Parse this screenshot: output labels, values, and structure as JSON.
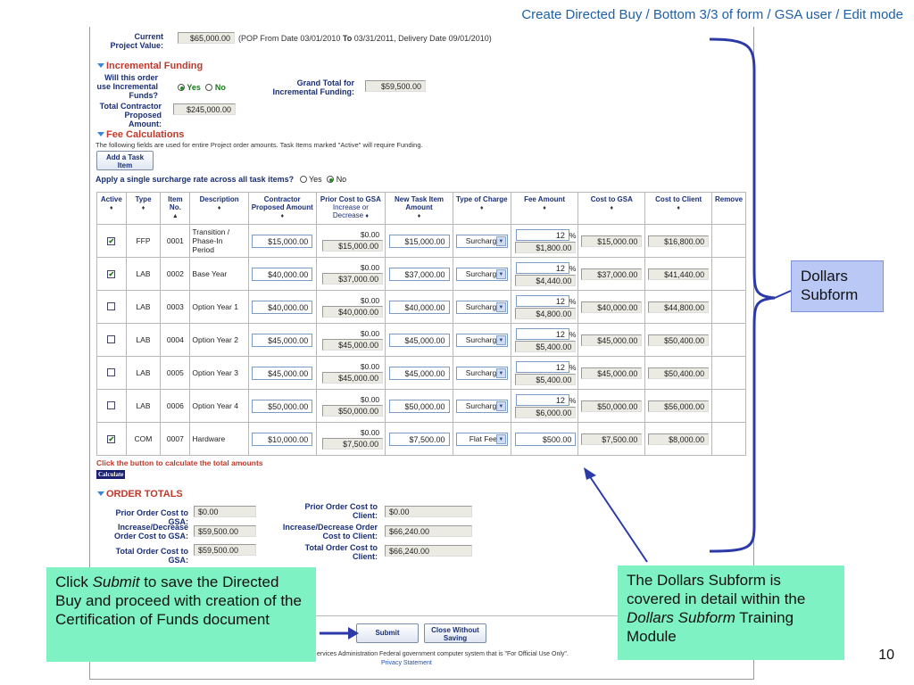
{
  "slide": {
    "title": "Create Directed Buy / Bottom 3/3 of form / GSA user / Edit mode",
    "page_number": "10"
  },
  "project": {
    "current_value_label": "Current Project Value:",
    "current_value": "$65,000.00",
    "pop_text_prefix": "(POP From Date 03/01/2010",
    "pop_to": "To",
    "pop_text_suffix": "03/31/2011, Delivery Date 09/01/2010)"
  },
  "incremental": {
    "title": "Incremental Funding",
    "question": "Will this order use Incremental Funds?",
    "yes": "Yes",
    "no": "No",
    "grand_total_label": "Grand Total for Incremental Funding:",
    "grand_total": "$59,500.00",
    "contractor_label": "Total Contractor Proposed Amount:",
    "contractor_amount": "$245,000.00"
  },
  "fees": {
    "title": "Fee Calculations",
    "note": "The following fields are used for entire Project order amounts. Task Items marked \"Active\" will require Funding.",
    "add_button": "Add a Task Item",
    "surcharge_question": "Apply a single surcharge rate across all task items?",
    "yes": "Yes",
    "no": "No"
  },
  "table": {
    "headers": {
      "active": "Active",
      "type": "Type",
      "item_no": "Item No.",
      "description": "Description",
      "contractor": "Contractor Proposed Amount",
      "prior": "Prior Cost to GSA",
      "prior_sub": "Increase or Decrease",
      "new_task": "New Task Item Amount",
      "charge_type": "Type of Charge",
      "fee": "Fee Amount",
      "cost_gsa": "Cost to GSA",
      "cost_client": "Cost to Client",
      "remove": "Remove"
    },
    "rows": [
      {
        "active": true,
        "type": "FFP",
        "item": "0001",
        "desc": "Transition / Phase-In Period",
        "contractor": "$15,000.00",
        "prior_delta": "$0.00",
        "prior": "$15,000.00",
        "new_amount": "$15,000.00",
        "charge": "Surcharge",
        "fee_pct": "12",
        "fee_amt": "$1,800.00",
        "gsa": "$15,000.00",
        "client": "$16,800.00"
      },
      {
        "active": true,
        "type": "LAB",
        "item": "0002",
        "desc": "Base Year",
        "contractor": "$40,000.00",
        "prior_delta": "$0.00",
        "prior": "$37,000.00",
        "new_amount": "$37,000.00",
        "charge": "Surcharge",
        "fee_pct": "12",
        "fee_amt": "$4,440.00",
        "gsa": "$37,000.00",
        "client": "$41,440.00"
      },
      {
        "active": false,
        "type": "LAB",
        "item": "0003",
        "desc": "Option Year 1",
        "contractor": "$40,000.00",
        "prior_delta": "$0.00",
        "prior": "$40,000.00",
        "new_amount": "$40,000.00",
        "charge": "Surcharge",
        "fee_pct": "12",
        "fee_amt": "$4,800.00",
        "gsa": "$40,000.00",
        "client": "$44,800.00"
      },
      {
        "active": false,
        "type": "LAB",
        "item": "0004",
        "desc": "Option Year 2",
        "contractor": "$45,000.00",
        "prior_delta": "$0.00",
        "prior": "$45,000.00",
        "new_amount": "$45,000.00",
        "charge": "Surcharge",
        "fee_pct": "12",
        "fee_amt": "$5,400.00",
        "gsa": "$45,000.00",
        "client": "$50,400.00"
      },
      {
        "active": false,
        "type": "LAB",
        "item": "0005",
        "desc": "Option Year 3",
        "contractor": "$45,000.00",
        "prior_delta": "$0.00",
        "prior": "$45,000.00",
        "new_amount": "$45,000.00",
        "charge": "Surcharge",
        "fee_pct": "12",
        "fee_amt": "$5,400.00",
        "gsa": "$45,000.00",
        "client": "$50,400.00"
      },
      {
        "active": false,
        "type": "LAB",
        "item": "0006",
        "desc": "Option Year 4",
        "contractor": "$50,000.00",
        "prior_delta": "$0.00",
        "prior": "$50,000.00",
        "new_amount": "$50,000.00",
        "charge": "Surcharge",
        "fee_pct": "12",
        "fee_amt": "$6,000.00",
        "gsa": "$50,000.00",
        "client": "$56,000.00"
      },
      {
        "active": true,
        "type": "COM",
        "item": "0007",
        "desc": "Hardware",
        "contractor": "$10,000.00",
        "prior_delta": "$0.00",
        "prior": "$7,500.00",
        "new_amount": "$7,500.00",
        "charge": "Flat Fee",
        "fee_pct": "",
        "fee_amt": "$500.00",
        "gsa": "$7,500.00",
        "client": "$8,000.00"
      }
    ],
    "percent_sign": "%",
    "sort_glyph": "♦",
    "sort_up_glyph": "▲"
  },
  "calc": {
    "hint": "Click the button to calculate the total amounts",
    "button": "Calculate"
  },
  "totals": {
    "title": "ORDER TOTALS",
    "prior_gsa_label": "Prior Order Cost to GSA:",
    "prior_gsa": "$0.00",
    "prior_client_label": "Prior Order Cost to Client:",
    "prior_client": "$0.00",
    "incdec_gsa_label": "Increase/Decrease Order Cost to GSA:",
    "incdec_gsa": "$59,500.00",
    "incdec_client_label": "Increase/Decrease Order Cost to Client:",
    "incdec_client": "$66,240.00",
    "total_gsa_label": "Total Order Cost to GSA:",
    "total_gsa": "$59,500.00",
    "total_client_label": "Total Order Cost to Client:",
    "total_client": "$66,240.00"
  },
  "footer": {
    "submit": "Submit",
    "close": "Close Without Saving",
    "disclaimer": "ervices Administration Federal government computer system that is \"For Official Use Only\".",
    "privacy": "Privacy Statement"
  },
  "callouts": {
    "submit_pre": "Click ",
    "submit_em": "Submit",
    "submit_post": " to save the Directed Buy and proceed with creation of the Certification of Funds document",
    "dollars_subform": "Dollars Subform",
    "detail_pre": "The Dollars Subform is covered in detail within the ",
    "detail_em": "Dollars Subform",
    "detail_post": " Training Module"
  },
  "colors": {
    "title_blue": "#1f5fa8",
    "section_red": "#c0392b",
    "label_navy": "#1a2f77",
    "callout_green": "#7ef2c2",
    "callout_blue": "#b9c8f5",
    "annotation_arrow": "#2b3aa8"
  }
}
